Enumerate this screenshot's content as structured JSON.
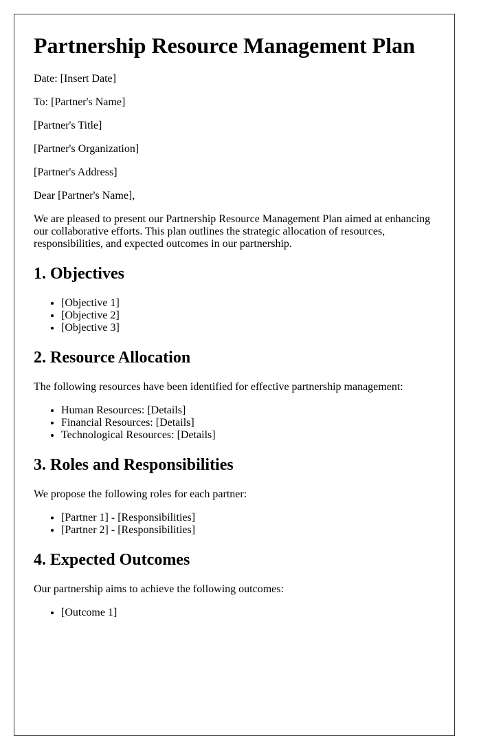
{
  "document": {
    "title": "Partnership Resource Management Plan",
    "header_lines": [
      "Date: [Insert Date]",
      "To: [Partner's Name]",
      "[Partner's Title]",
      "[Partner's Organization]",
      "[Partner's Address]"
    ],
    "salutation": "Dear [Partner's Name],",
    "intro": "We are pleased to present our Partnership Resource Management Plan aimed at enhancing our collaborative efforts. This plan outlines the strategic allocation of resources, responsibilities, and expected outcomes in our partnership.",
    "sections": [
      {
        "heading": "1. Objectives",
        "lead": "",
        "items": [
          "[Objective 1]",
          "[Objective 2]",
          "[Objective 3]"
        ]
      },
      {
        "heading": "2. Resource Allocation",
        "lead": "The following resources have been identified for effective partnership management:",
        "items": [
          "Human Resources: [Details]",
          "Financial Resources: [Details]",
          "Technological Resources: [Details]"
        ]
      },
      {
        "heading": "3. Roles and Responsibilities",
        "lead": "We propose the following roles for each partner:",
        "items": [
          "[Partner 1] - [Responsibilities]",
          "[Partner 2] - [Responsibilities]"
        ]
      },
      {
        "heading": "4. Expected Outcomes",
        "lead": "Our partnership aims to achieve the following outcomes:",
        "items": [
          "[Outcome 1]"
        ]
      }
    ]
  }
}
